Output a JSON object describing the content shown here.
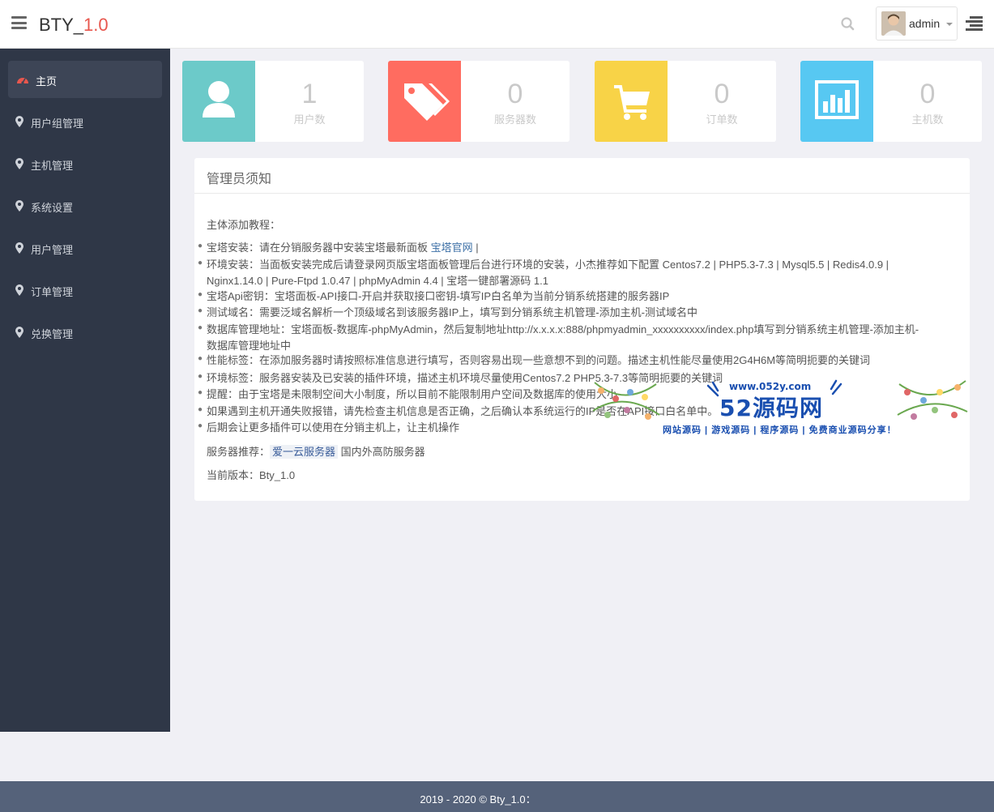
{
  "header": {
    "brand_prefix": "BTY_",
    "brand_version": "1.0",
    "user_name": "admin",
    "menu_icon": "hamburger-icon",
    "search_icon": "search-icon"
  },
  "sidebar": {
    "items": [
      {
        "label": "主页",
        "icon": "dashboard-icon",
        "active": true
      },
      {
        "label": "用户组管理",
        "icon": "map-marker-icon"
      },
      {
        "label": "主机管理",
        "icon": "map-marker-icon"
      },
      {
        "label": "系统设置",
        "icon": "map-marker-icon"
      },
      {
        "label": "用户管理",
        "icon": "map-marker-icon"
      },
      {
        "label": "订单管理",
        "icon": "map-marker-icon"
      },
      {
        "label": "兑换管理",
        "icon": "map-marker-icon"
      }
    ]
  },
  "stats": [
    {
      "value": "1",
      "label": "用户数",
      "icon": "user-icon",
      "color": "#6ccac9"
    },
    {
      "value": "0",
      "label": "服务器数",
      "icon": "tags-icon",
      "color": "#ff6c60"
    },
    {
      "value": "0",
      "label": "订单数",
      "icon": "cart-icon",
      "color": "#f8d347"
    },
    {
      "value": "0",
      "label": "主机数",
      "icon": "bar-chart-icon",
      "color": "#57c8f2"
    }
  ],
  "panel": {
    "title": "管理员须知",
    "intro": "主体添加教程：",
    "lines": [
      {
        "pre": "宝塔安装：请在分销服务器中安装宝塔最新面板 ",
        "link": "宝塔官网",
        "post": " |"
      },
      {
        "pre": "环境安装：当面板安装完成后请登录网页版宝塔面板管理后台进行环境的安装，小杰推荐如下配置 Centos7.2 | PHP5.3-7.3 | Mysql5.5 | Redis4.0.9 |",
        "cont": "Nginx1.14.0 | Pure-Ftpd 1.0.47 | phpMyAdmin 4.4 | 宝塔一键部署源码 1.1"
      },
      {
        "pre": "宝塔Api密钥：宝塔面板-API接口-开启并获取接口密钥-填写IP白名单为当前分销系统搭建的服务器IP"
      },
      {
        "pre": "测试域名：需要泛域名解析一个顶级域名到该服务器IP上，填写到分销系统主机管理-添加主机-测试域名中"
      },
      {
        "pre": "数据库管理地址：宝塔面板-数据库-phpMyAdmin，然后复制地址http://x.x.x.x:888/phpmyadmin_xxxxxxxxxx/index.php填写到分销系统主机管理-添加主机-",
        "cont": "数据库管理地址中"
      },
      {
        "pre": "性能标签：在添加服务器时请按照标准信息进行填写，否则容易出现一些意想不到的问题。描述主机性能尽量使用2G4H6M等简明扼要的关键词"
      },
      {
        "pre": "环境标签：服务器安装及已安装的插件环境，描述主机环境尽量使用Centos7.2 PHP5.3-7.3等简明扼要的关键词"
      },
      {
        "pre": "提醒：由于宝塔是未限制空间大小制度，所以目前不能限制用户空间及数据库的使用大小"
      },
      {
        "pre": "如果遇到主机开通失败报错，请先检查主机信息是否正确，之后确认本系统运行的IP是否在API接口白名单中。"
      },
      {
        "pre": "后期会让更多插件可以使用在分销主机上，让主机操作"
      }
    ],
    "recommend_label": "服务器推荐：",
    "recommend_tag": "爱一云服务器",
    "recommend_suffix": " 国内外高防服务器",
    "version_line": "当前版本：Bty_1.0"
  },
  "watermark": {
    "url": "www.052y.com",
    "title": "52源码网",
    "subtitle": "网站源码 | 游戏源码 | 程序源码 | 免费商业源码分享！"
  },
  "footer": {
    "text": "2019 - 2020 © Bty_1.0："
  }
}
